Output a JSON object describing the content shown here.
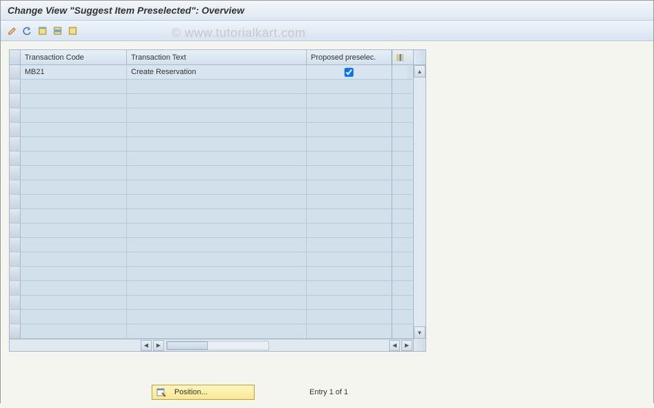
{
  "title": "Change View \"Suggest Item Preselected\": Overview",
  "watermark": "© www.tutorialkart.com",
  "toolbar": {
    "change_icon": "change",
    "undo_icon": "undo",
    "select_all_icon": "select-all",
    "deselect_icon": "deselect",
    "delete_icon": "delete"
  },
  "table": {
    "columns": {
      "tcode": "Transaction Code",
      "ttext": "Transaction Text",
      "preselec": "Proposed preselec."
    },
    "rows": [
      {
        "tcode": "MB21",
        "ttext": "Create Reservation",
        "preselec": true
      }
    ],
    "empty_rows": 18
  },
  "footer": {
    "position_label": "Position...",
    "entry_text": "Entry 1 of 1"
  }
}
